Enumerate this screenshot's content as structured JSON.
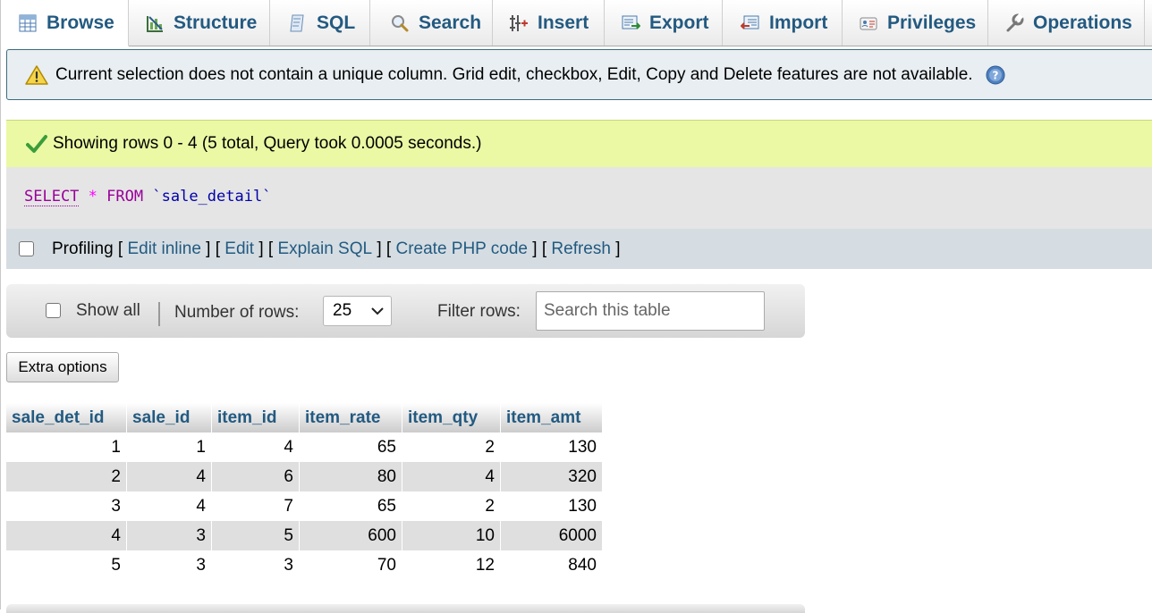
{
  "tabs": [
    {
      "label": "Browse",
      "icon": "browse-icon"
    },
    {
      "label": "Structure",
      "icon": "structure-icon"
    },
    {
      "label": "SQL",
      "icon": "sql-icon"
    },
    {
      "label": "Search",
      "icon": "search-icon"
    },
    {
      "label": "Insert",
      "icon": "insert-icon"
    },
    {
      "label": "Export",
      "icon": "export-icon"
    },
    {
      "label": "Import",
      "icon": "import-icon"
    },
    {
      "label": "Privileges",
      "icon": "privileges-icon"
    },
    {
      "label": "Operations",
      "icon": "operations-icon"
    }
  ],
  "active_tab": "Browse",
  "notice": {
    "text": "Current selection does not contain a unique column. Grid edit, checkbox, Edit, Copy and Delete features are not available.",
    "icon": "warning-icon",
    "help_icon": "help-icon"
  },
  "success": {
    "text": "Showing rows 0 - 4 (5 total, Query took 0.0005 seconds.)",
    "icon": "checkmark-icon"
  },
  "sql": {
    "select_kw": "SELECT",
    "star": "*",
    "from_kw": "FROM",
    "table": "`sale_detail`"
  },
  "profiling": {
    "label": "Profiling",
    "links": [
      "Edit inline",
      "Edit",
      "Explain SQL",
      "Create PHP code",
      "Refresh"
    ]
  },
  "nav": {
    "show_all_label": "Show all",
    "number_of_rows_label": "Number of rows:",
    "number_of_rows_value": "25",
    "filter_label": "Filter rows:",
    "search_placeholder": "Search this table"
  },
  "extra_options_label": "Extra options",
  "grid": {
    "columns": [
      "sale_det_id",
      "sale_id",
      "item_id",
      "item_rate",
      "item_qty",
      "item_amt"
    ],
    "rows": [
      [
        "1",
        "1",
        "4",
        "65",
        "2",
        "130"
      ],
      [
        "2",
        "4",
        "6",
        "80",
        "4",
        "320"
      ],
      [
        "3",
        "4",
        "7",
        "65",
        "2",
        "130"
      ],
      [
        "4",
        "3",
        "5",
        "600",
        "10",
        "6000"
      ],
      [
        "5",
        "3",
        "3",
        "70",
        "12",
        "840"
      ]
    ]
  },
  "colors": {
    "link": "#235a81",
    "success_bg": "#ebf8a4",
    "notice_bg": "#e8eef1",
    "notice_border": "#3a6c7e",
    "sql_keyword": "#990099"
  }
}
